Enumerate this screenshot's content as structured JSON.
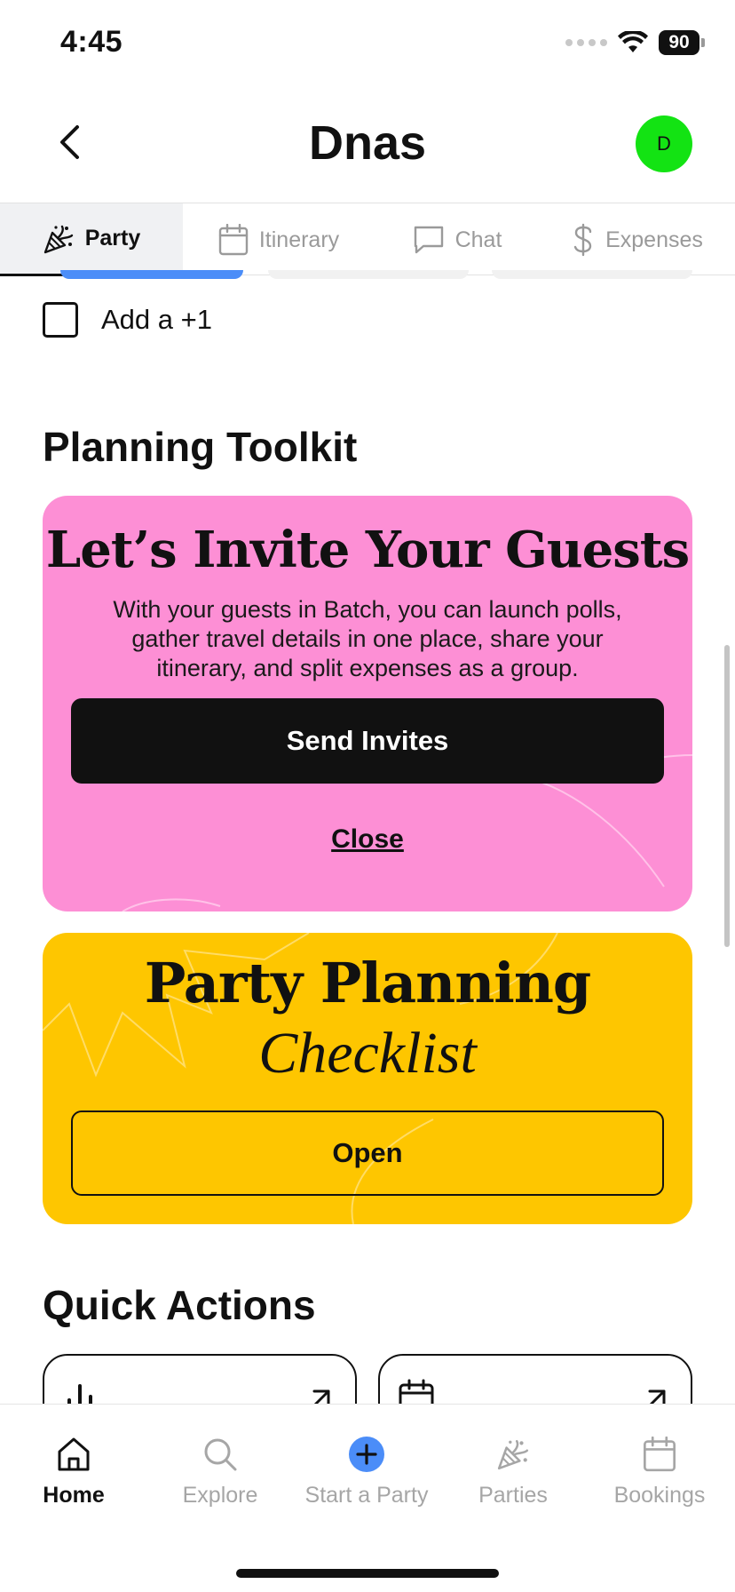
{
  "status_bar": {
    "time": "4:45",
    "battery": "90"
  },
  "header": {
    "title": "Dnas",
    "avatar_initial": "D",
    "avatar_color": "#13e313"
  },
  "tabs": [
    {
      "label": "Party",
      "icon": "party-popper-icon",
      "active": true
    },
    {
      "label": "Itinerary",
      "icon": "calendar-icon",
      "active": false
    },
    {
      "label": "Chat",
      "icon": "chat-bubble-icon",
      "active": false
    },
    {
      "label": "Expenses",
      "icon": "dollar-icon",
      "active": false
    }
  ],
  "plus_one": {
    "label": "Add a +1",
    "checked": false
  },
  "planning_toolkit": {
    "title": "Planning Toolkit",
    "invite_card": {
      "title": "Let’s Invite Your Guests",
      "description": "With your guests in Batch, you can launch polls, gather travel details in one place, share your itinerary, and split expenses as a group.",
      "button": "Send Invites",
      "close": "Close",
      "color": "#fd8fd5"
    },
    "checklist_card": {
      "title": "Party Planning",
      "subtitle": "Checklist",
      "button": "Open",
      "color": "#fec600"
    }
  },
  "quick_actions": {
    "title": "Quick Actions",
    "items": [
      {
        "icon": "bar-chart-icon"
      },
      {
        "icon": "calendar-icon"
      }
    ]
  },
  "bottom_nav": [
    {
      "label": "Home",
      "icon": "home-icon",
      "active": true
    },
    {
      "label": "Explore",
      "icon": "search-icon",
      "active": false
    },
    {
      "label": "Start a Party",
      "icon": "plus-circle-icon",
      "active": false
    },
    {
      "label": "Parties",
      "icon": "party-popper-icon",
      "active": false
    },
    {
      "label": "Bookings",
      "icon": "calendar-icon",
      "active": false
    }
  ],
  "colors": {
    "accent_blue": "#4b8df8",
    "text": "#111111",
    "muted": "#a6a6a6"
  }
}
